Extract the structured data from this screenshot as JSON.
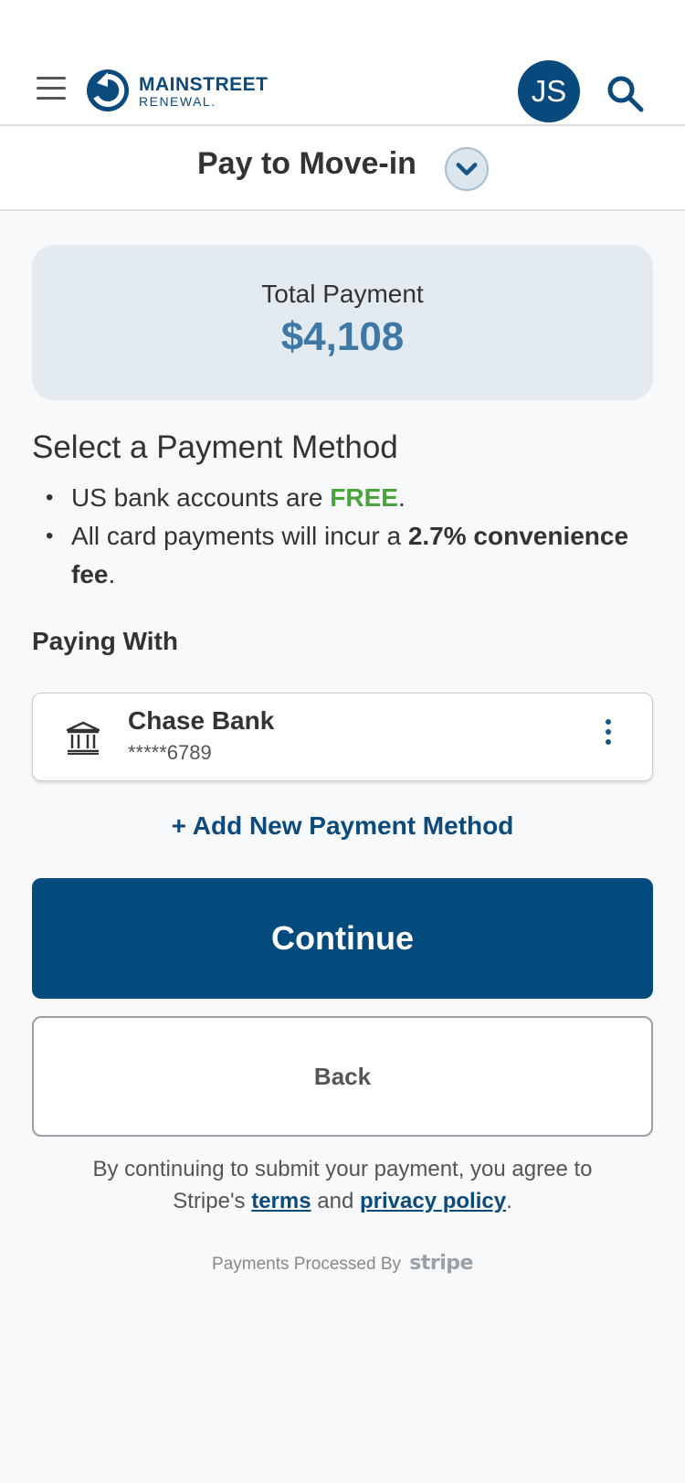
{
  "header": {
    "logo_line1": "MAINSTREET",
    "logo_line2": "RENEWAL.",
    "avatar_initials": "JS"
  },
  "subheader": {
    "title": "Pay to Move-in"
  },
  "total": {
    "label": "Total Payment",
    "amount": "$4,108"
  },
  "payment_method": {
    "title": "Select a Payment Method",
    "bullet1_prefix": "US bank accounts are ",
    "bullet1_highlight": "FREE",
    "bullet1_suffix": ".",
    "bullet2_prefix": "All card payments will incur a ",
    "bullet2_bold": "2.7% convenience fee",
    "bullet2_suffix": "."
  },
  "paying_with": {
    "label": "Paying With",
    "bank_name": "Chase Bank",
    "account_masked": "*****6789"
  },
  "actions": {
    "add_new": "+ Add New Payment Method",
    "continue": "Continue",
    "back": "Back"
  },
  "legal": {
    "prefix": "By continuing to submit your payment, you agree to Stripe's ",
    "terms": "terms",
    "middle": " and ",
    "privacy": "privacy policy",
    "suffix": "."
  },
  "footer": {
    "processed_by": "Payments Processed By",
    "stripe": "stripe"
  },
  "colors": {
    "brand": "#034a7d",
    "amount": "#3e78a6",
    "free": "#4aa33b",
    "card_bg": "#e3ebf0"
  },
  "icons": [
    "hamburger-icon",
    "search-icon",
    "chevron-down-icon",
    "bank-icon",
    "kebab-menu-icon"
  ]
}
